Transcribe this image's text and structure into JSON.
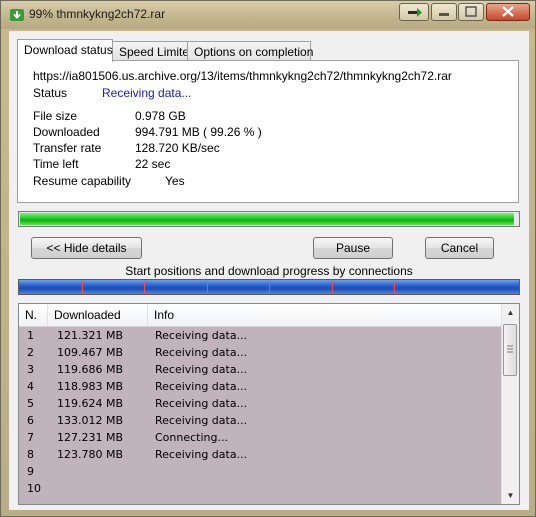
{
  "window": {
    "title": "99% thmnkykng2ch72.rar",
    "buttons": {
      "minimize": "minimize",
      "restore": "restore",
      "close": "close"
    }
  },
  "tabs": [
    {
      "label": "Download status",
      "active": true
    },
    {
      "label": "Speed Limiter",
      "active": false
    },
    {
      "label": "Options on completion",
      "active": false
    }
  ],
  "status": {
    "url": "https://ia801506.us.archive.org/13/items/thmnkykng2ch72/thmnkykng2ch72.rar",
    "status_label": "Status",
    "status_value": "Receiving data...",
    "file_size_label": "File size",
    "file_size_value": "0.978  GB",
    "downloaded_label": "Downloaded",
    "downloaded_value": "994.791  MB  ( 99.26 % )",
    "transfer_rate_label": "Transfer rate",
    "transfer_rate_value": "128.720  KB/sec",
    "time_left_label": "Time left",
    "time_left_value": "22 sec",
    "resume_label": "Resume capability",
    "resume_value": "Yes"
  },
  "progress": {
    "fraction": 0.9926
  },
  "buttons": {
    "hide_details": "<< Hide details",
    "pause": "Pause",
    "cancel": "Cancel"
  },
  "connections": {
    "caption": "Start positions and download progress by connections",
    "start_fractions": [
      0.125,
      0.25,
      0.375,
      0.5,
      0.625,
      0.75
    ]
  },
  "list": {
    "columns": [
      "N.",
      "Downloaded",
      "Info"
    ],
    "rows": [
      {
        "n": "1",
        "downloaded": "121.321  MB",
        "info": "Receiving data..."
      },
      {
        "n": "2",
        "downloaded": "109.467  MB",
        "info": "Receiving data..."
      },
      {
        "n": "3",
        "downloaded": "119.686  MB",
        "info": "Receiving data..."
      },
      {
        "n": "4",
        "downloaded": "118.983  MB",
        "info": "Receiving data..."
      },
      {
        "n": "5",
        "downloaded": "119.624  MB",
        "info": "Receiving data..."
      },
      {
        "n": "6",
        "downloaded": "133.012  MB",
        "info": "Receiving data..."
      },
      {
        "n": "7",
        "downloaded": "127.231  MB",
        "info": "Connecting..."
      },
      {
        "n": "8",
        "downloaded": "123.780  MB",
        "info": "Receiving data..."
      },
      {
        "n": "9",
        "downloaded": "",
        "info": ""
      },
      {
        "n": "10",
        "downloaded": "",
        "info": ""
      }
    ]
  },
  "colors": {
    "progress_green": "#1fc41f",
    "connection_blue": "#2a5fcf",
    "connection_marker": "#ff4a4a",
    "list_background": "#c0b3ba",
    "status_link": "#1a1ab8"
  }
}
